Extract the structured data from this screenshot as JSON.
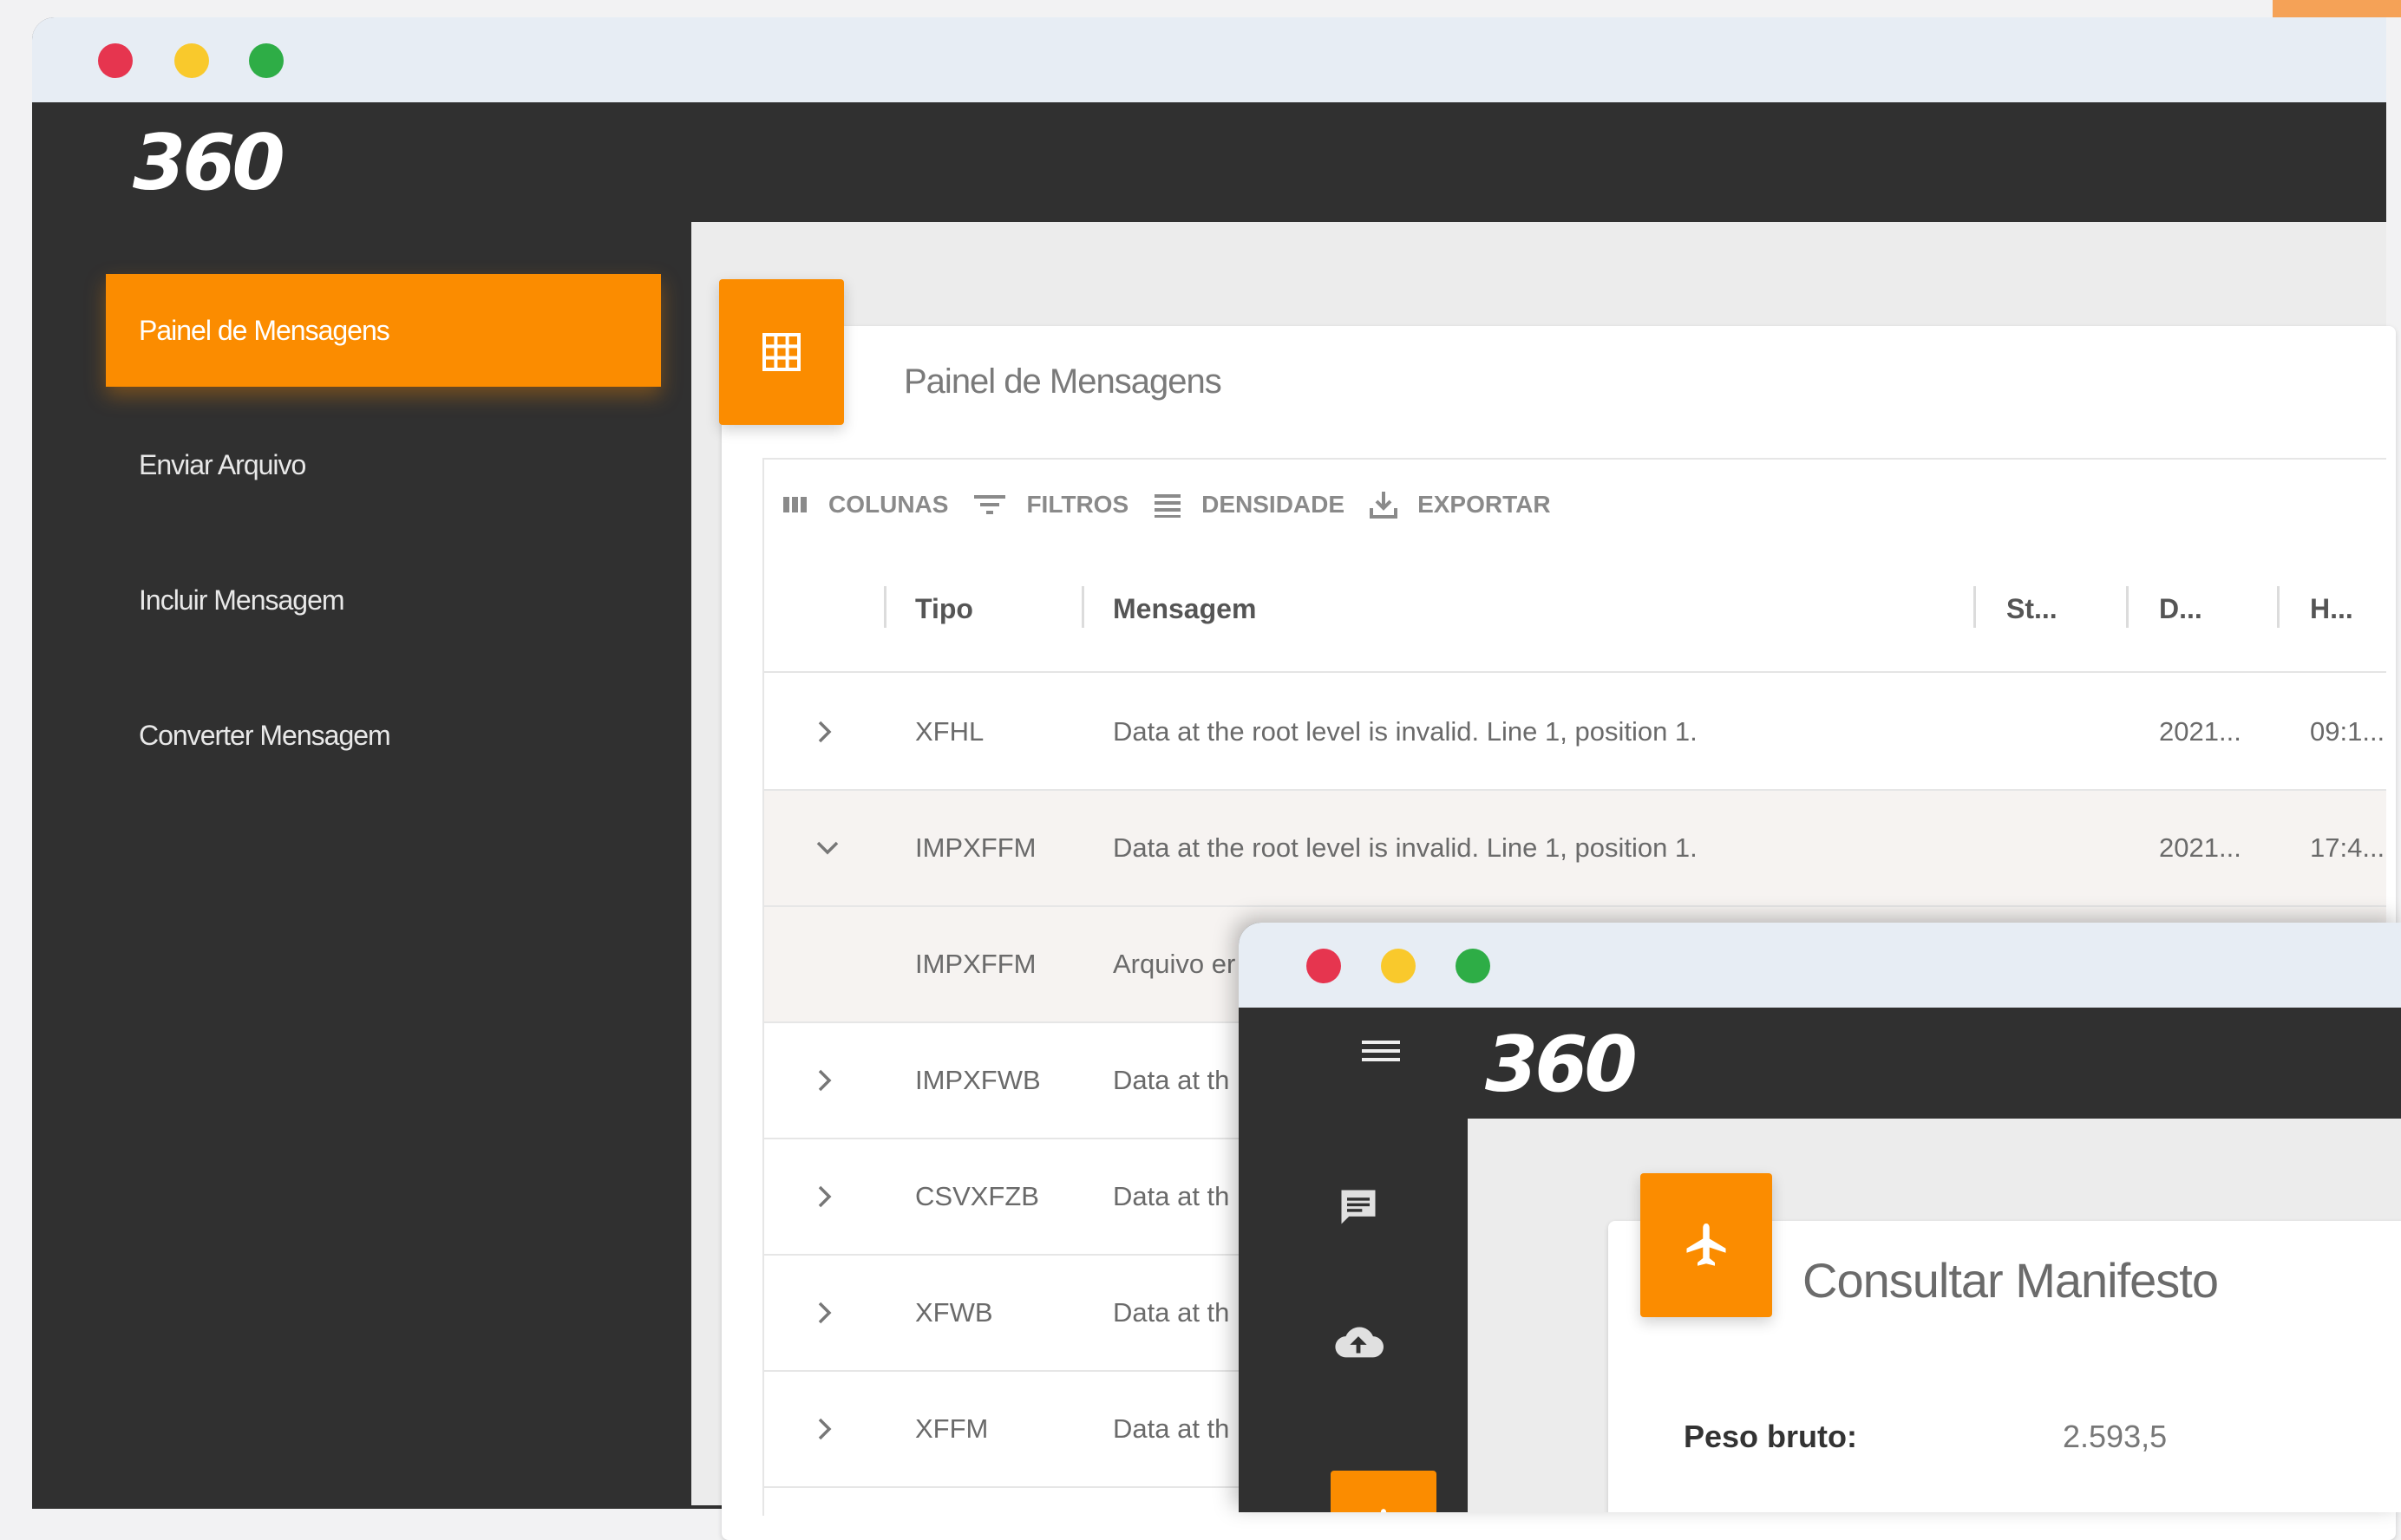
{
  "back_window": {
    "logo": "360",
    "sidebar": {
      "items": [
        {
          "label": "Painel de Mensagens",
          "active": true
        },
        {
          "label": "Enviar Arquivo",
          "active": false
        },
        {
          "label": "Incluir Mensagem",
          "active": false
        },
        {
          "label": "Converter Mensagem",
          "active": false
        }
      ]
    },
    "page": {
      "title": "Painel de Mensagens",
      "icon": "grid-icon"
    },
    "toolbar": {
      "columns": "COLUNAS",
      "filters": "FILTROS",
      "density": "DENSIDADE",
      "export": "EXPORTAR"
    },
    "table": {
      "headers": [
        "Tipo",
        "Mensagem",
        "St...",
        "D...",
        "H..."
      ],
      "rows": [
        {
          "tipo": "XFHL",
          "mensagem": "Data at the root level is invalid. Line 1, position 1.",
          "data": "2021...",
          "hora": "09:1...",
          "state": "collapsed"
        },
        {
          "tipo": "IMPXFFM",
          "mensagem": "Data at the root level is invalid. Line 1, position 1.",
          "data": "2021...",
          "hora": "17:4...",
          "state": "expanded"
        },
        {
          "tipo": "IMPXFFM",
          "mensagem": "Arquivo er",
          "data": "",
          "hora": "",
          "state": "detail"
        },
        {
          "tipo": "IMPXFWB",
          "mensagem": "Data at th",
          "data": "",
          "hora": "",
          "state": "collapsed"
        },
        {
          "tipo": "CSVXFZB",
          "mensagem": "Data at th",
          "data": "",
          "hora": "",
          "state": "collapsed"
        },
        {
          "tipo": "XFWB",
          "mensagem": "Data at th",
          "data": "",
          "hora": "",
          "state": "collapsed"
        },
        {
          "tipo": "XFFM",
          "mensagem": "Data at th",
          "data": "",
          "hora": "",
          "state": "collapsed"
        }
      ]
    }
  },
  "front_window": {
    "logo": "360",
    "page": {
      "title": "Consultar Manifesto",
      "icon": "airplane-icon"
    },
    "fields": [
      {
        "label": "Peso bruto:",
        "value": "2.593,5"
      }
    ],
    "sidebar_icons": [
      "message-icon",
      "cloud-upload-icon",
      "airplane-icon"
    ]
  },
  "colors": {
    "accent": "#fb8c00",
    "dark": "#303030",
    "titlebar": "#e7edf4"
  }
}
